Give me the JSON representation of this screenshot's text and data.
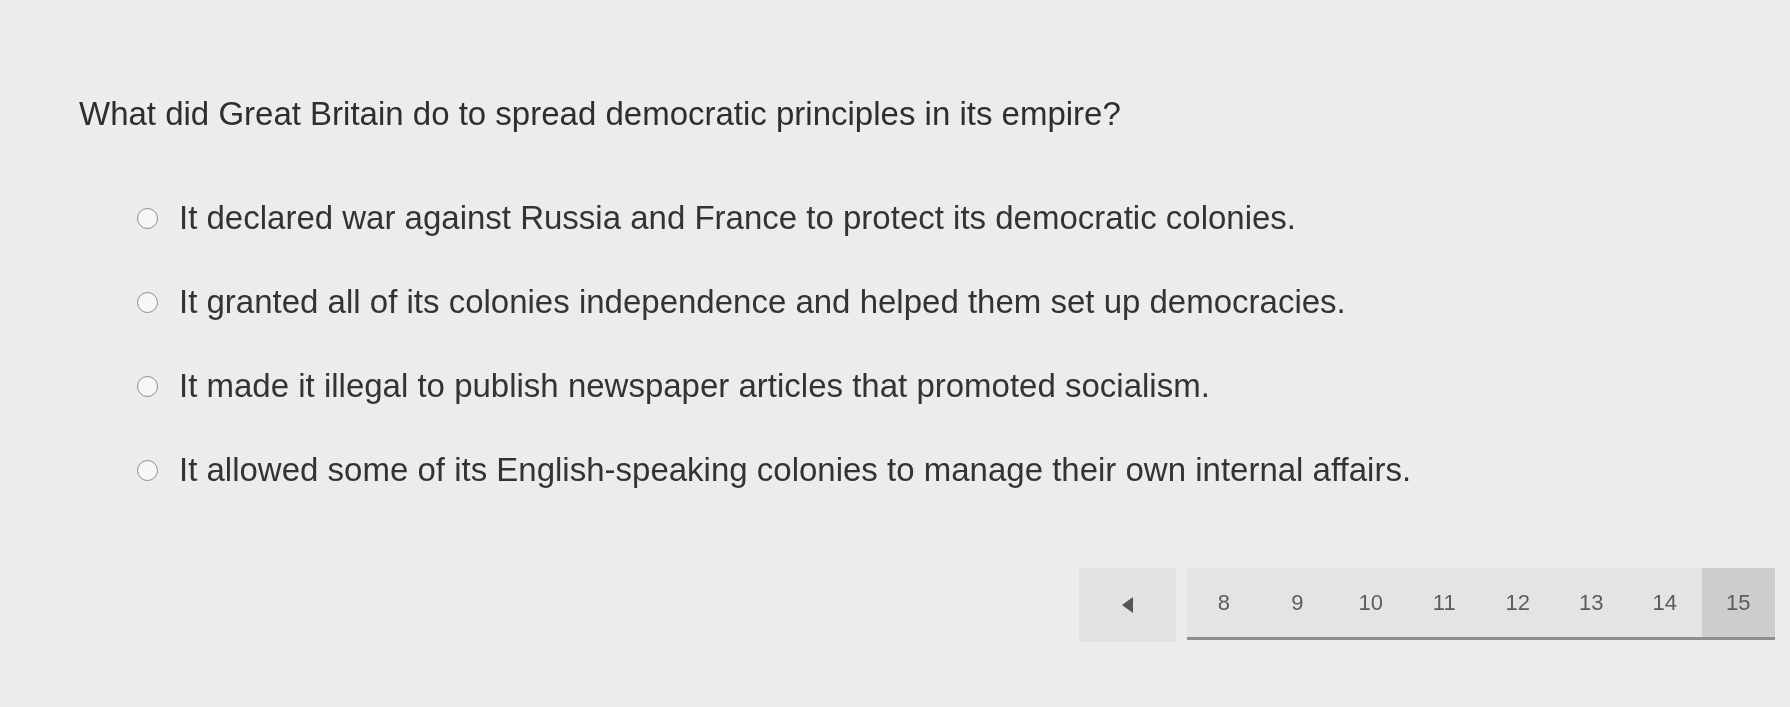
{
  "question": {
    "text": "What did Great Britain do to spread democratic principles in its empire?"
  },
  "options": [
    {
      "label": "It declared war against Russia and France to protect its democratic colonies.",
      "selected": false
    },
    {
      "label": "It granted all of its colonies independence and helped them set up democracies.",
      "selected": false
    },
    {
      "label": "It made it illegal to publish newspaper articles that promoted socialism.",
      "selected": false
    },
    {
      "label": "It allowed some of its English-speaking colonies to manage their own internal affairs.",
      "selected": false
    }
  ],
  "pagination": {
    "pages": [
      {
        "label": "8",
        "selected": false
      },
      {
        "label": "9",
        "selected": false
      },
      {
        "label": "10",
        "selected": false
      },
      {
        "label": "11",
        "selected": false
      },
      {
        "label": "12",
        "selected": false
      },
      {
        "label": "13",
        "selected": false
      },
      {
        "label": "14",
        "selected": false
      },
      {
        "label": "15",
        "selected": true
      }
    ]
  }
}
